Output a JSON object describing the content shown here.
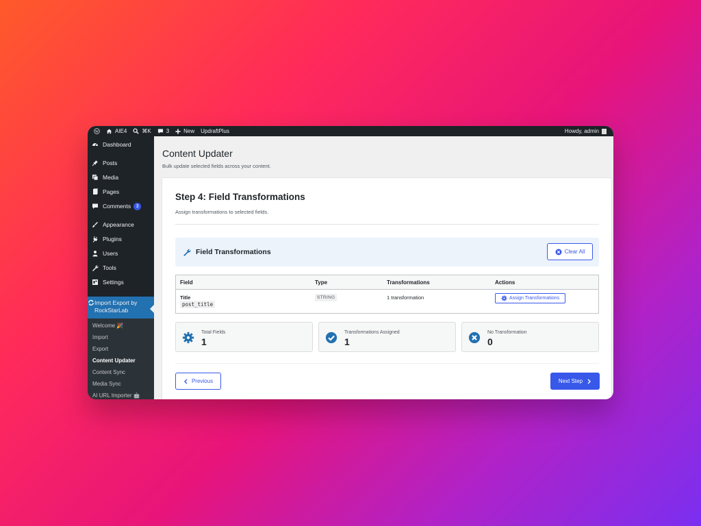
{
  "admin_bar": {
    "site_name": "AIE4",
    "shortcut": "⌘K",
    "comments_count": "3",
    "new_label": "New",
    "plugin_label": "UpdraftPlus",
    "howdy": "Howdy, admin"
  },
  "sidebar": {
    "items": [
      {
        "label": "Dashboard",
        "icon": "dashboard-icon"
      },
      {
        "label": "Posts",
        "icon": "pin-icon"
      },
      {
        "label": "Media",
        "icon": "media-icon"
      },
      {
        "label": "Pages",
        "icon": "pages-icon"
      },
      {
        "label": "Comments",
        "icon": "comment-icon",
        "badge": "3"
      },
      {
        "label": "Appearance",
        "icon": "brush-icon"
      },
      {
        "label": "Plugins",
        "icon": "plug-icon"
      },
      {
        "label": "Users",
        "icon": "user-icon"
      },
      {
        "label": "Tools",
        "icon": "wrench-icon"
      },
      {
        "label": "Settings",
        "icon": "settings-icon"
      }
    ],
    "current": {
      "label_line1": "Import Export by",
      "label_line2": "RockStarLab",
      "icon": "sync-icon"
    },
    "submenu": [
      "Welcome 🎉",
      "Import",
      "Export",
      "Content Updater",
      "Content Sync",
      "Media Sync",
      "AI URL Importer 🤖"
    ],
    "active_sub": "Content Updater"
  },
  "page": {
    "title": "Content Updater",
    "subtitle": "Bulk update selected fields across your content."
  },
  "step": {
    "title": "Step 4: Field Transformations",
    "description": "Assign transformations to selected fields."
  },
  "panel": {
    "title": "Field Transformations",
    "clear_all": "Clear All"
  },
  "table": {
    "headers": [
      "Field",
      "Type",
      "Transformations",
      "Actions"
    ],
    "rows": [
      {
        "field_label": "Title",
        "field_key": "post_title",
        "type": "STRING",
        "transformations": "1 transformation",
        "action": "Assign Transformations"
      }
    ]
  },
  "stats": [
    {
      "label": "Total Fields",
      "value": "1",
      "icon": "gear-icon",
      "color": "#2271b1"
    },
    {
      "label": "Transformations Assigned",
      "value": "1",
      "icon": "check-circle-icon",
      "color": "#2271b1"
    },
    {
      "label": "No Transformation",
      "value": "0",
      "icon": "x-circle-icon",
      "color": "#2271b1"
    }
  ],
  "nav": {
    "previous": "Previous",
    "next": "Next Step"
  },
  "colors": {
    "accent": "#3858e9",
    "admin_dark": "#1d2327",
    "current_menu": "#2271b1"
  }
}
